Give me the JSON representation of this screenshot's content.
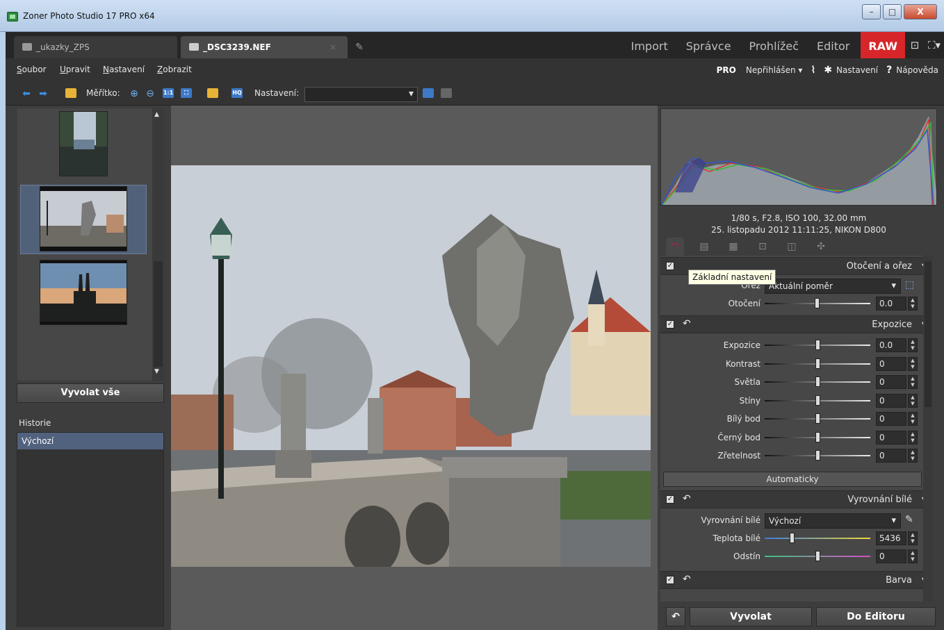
{
  "window": {
    "title": "Zoner Photo Studio 17 PRO x64",
    "buttons": [
      "–",
      "□",
      "X"
    ]
  },
  "tabs": [
    {
      "label": "_ukazky_ZPS"
    },
    {
      "label": "_DSC3239.NEF",
      "close": "×"
    }
  ],
  "modes": {
    "items": [
      "Import",
      "Správce",
      "Prohlížeč",
      "Editor"
    ],
    "raw": "RAW",
    "icons": [
      "monitor-icon",
      "fullscreen-icon"
    ]
  },
  "menu": {
    "items": [
      "Soubor",
      "Upravit",
      "Nastavení",
      "Zobrazit"
    ],
    "pro": "PRO",
    "user": "Nepřihlášen ▾",
    "nastaveni": "Nastavení",
    "napoveda": "Nápověda"
  },
  "toolbar": {
    "meritko": "Měřítko:",
    "nastaveni": "Nastavení:",
    "one_to_one": "1:1",
    "hq": "HQ"
  },
  "left": {
    "vyvolat_vse": "Vyvolat vše",
    "historie": "Historie",
    "history_items": [
      "Výchozí"
    ]
  },
  "info": {
    "exposure": "1/80 s, F2.8, ISO 100, 32.00 mm",
    "datetime": "25. listopadu 2012 11:11:25, NIKON D800"
  },
  "tooltip": "Základní nastavení",
  "settings": {
    "crop_section": "Otočení a ořez",
    "orez_label": "Ořez",
    "orez_value": "Aktuální poměr",
    "otoceni_label": "Otočení",
    "otoceni_value": "0.0",
    "exposure_section": "Expozice",
    "exposure_rows": [
      {
        "label": "Expozice",
        "value": "0.0",
        "level": 0.5
      },
      {
        "label": "Kontrast",
        "value": "0",
        "level": 0.5
      },
      {
        "label": "Světla",
        "value": "0",
        "level": 0.5
      },
      {
        "label": "Stíny",
        "value": "0",
        "level": 0.5
      },
      {
        "label": "Bílý bod",
        "value": "0",
        "level": 0.5
      },
      {
        "label": "Černý bod",
        "value": "0",
        "level": 0.5
      },
      {
        "label": "Zřetelnost",
        "value": "0",
        "level": 0.5
      }
    ],
    "auto_button": "Automaticky",
    "wb_section": "Vyrovnání bílé",
    "wb_label": "Vyrovnání bílé",
    "wb_value": "Výchozí",
    "teplota_label": "Teplota bílé",
    "teplota_value": "5436",
    "teplota_level": 0.25,
    "odstin_label": "Odstín",
    "odstin_value": "0",
    "odstin_level": 0.5,
    "color_section": "Barva"
  },
  "bottom": {
    "vyvolat": "Vyvolat",
    "do_editoru": "Do Editoru"
  }
}
